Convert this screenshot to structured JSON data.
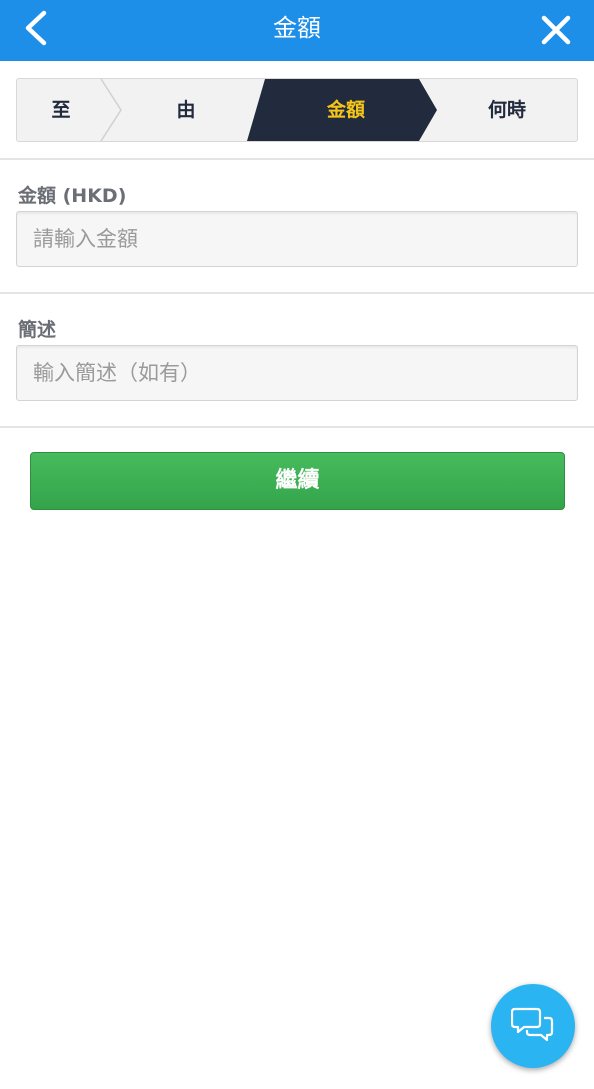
{
  "header": {
    "title": "金額",
    "back_icon": "chevron-left-icon",
    "close_icon": "close-icon",
    "color": "#1e8fe8"
  },
  "stepper": {
    "steps": [
      {
        "label": "至",
        "active": false
      },
      {
        "label": "由",
        "active": false
      },
      {
        "label": "金額",
        "active": true
      },
      {
        "label": "何時",
        "active": false
      }
    ],
    "active_color": "#222b3d",
    "active_text_color": "#f5c518"
  },
  "form": {
    "amount": {
      "label": "金額 (HKD)",
      "placeholder": "請輸入金額",
      "value": ""
    },
    "description": {
      "label": "簡述",
      "placeholder": "輸入簡述（如有）",
      "value": ""
    }
  },
  "actions": {
    "continue_label": "繼續",
    "continue_color": "#3cae52"
  },
  "chat": {
    "icon": "chat-bubbles-icon",
    "color": "#2ab4f2"
  }
}
